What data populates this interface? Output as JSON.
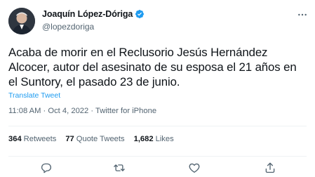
{
  "author": {
    "display_name": "Joaquín López-Dóriga",
    "handle": "@lopezdoriga"
  },
  "tweet": {
    "text": "Acaba de morir en el Reclusorio Jesús Hernández Alcocer, autor del asesinato de su esposa el 21 años en el Suntory, el pasado 23 de junio.",
    "translate_label": "Translate Tweet",
    "time": "11:08 AM",
    "separator": " · ",
    "date": "Oct 4, 2022",
    "source": "Twitter for iPhone"
  },
  "stats": {
    "retweets": {
      "count": "364",
      "label": "Retweets"
    },
    "quotes": {
      "count": "77",
      "label": "Quote Tweets"
    },
    "likes": {
      "count": "1,682",
      "label": "Likes"
    }
  },
  "icons": {
    "verified": "verified-badge-icon",
    "more": "more-options-icon",
    "reply": "reply-icon",
    "retweet": "retweet-icon",
    "like": "like-icon",
    "share": "share-icon"
  },
  "colors": {
    "accent": "#1d9bf0",
    "text": "#0f1419",
    "secondary": "#536471",
    "divider": "#eff3f4"
  }
}
